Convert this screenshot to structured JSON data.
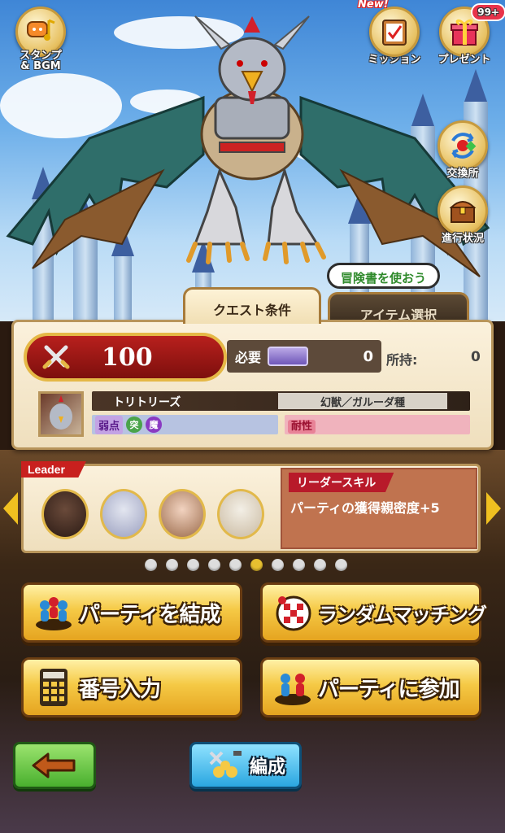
{
  "hud": {
    "stamp_bgm": "スタンプ\n& BGM",
    "mission": "ミッション",
    "mission_new": "New!",
    "present": "プレゼント",
    "present_badge": "99+",
    "exchange": "交換所",
    "progress": "進行状況"
  },
  "tabs": {
    "quest_conditions": "クエスト条件",
    "item_select": "アイテム選択",
    "hint_bubble": "冒険書を使おう"
  },
  "conditions": {
    "stamina": "100",
    "required_label": "必要",
    "required_value": "0",
    "owned_label": "所持:",
    "owned_value": "0",
    "boss_name": "トリトリーズ",
    "boss_type": "幻獣／ガルーダ種",
    "weakness_label": "弱点",
    "weakness_elements": [
      "突",
      "魔"
    ],
    "resistance_label": "耐性"
  },
  "party": {
    "leader_tag": "Leader",
    "skill_title": "リーダースキル",
    "skill_text": "パーティの獲得親密度+5",
    "page_count": 10,
    "active_page": 6
  },
  "buttons": {
    "form_party": "パーティを結成",
    "random_matching": "ランダムマッチング",
    "number_input": "番号入力",
    "join_party": "パーティに参加",
    "edit": "編成"
  },
  "colors": {
    "gold_button": "#f5c945",
    "stamina_red": "#b8201d",
    "back_green": "#49b02e",
    "edit_blue": "#2aa6e0"
  }
}
